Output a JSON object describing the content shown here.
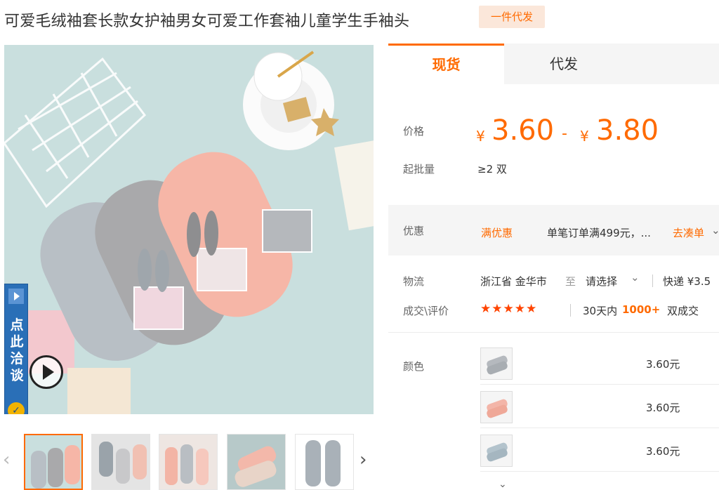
{
  "header": {
    "title": "可爱毛绒袖套长款女护袖男女可爱工作套袖儿童学生手袖头",
    "badge": "一件代发"
  },
  "gallery": {
    "chat_text": "点此洽谈",
    "chat_badge_icon": "shield-icon",
    "play_icon": "play-icon",
    "thumbnail_count": 5,
    "active_thumbnail": 1
  },
  "tabs": [
    {
      "label": "现货",
      "active": true
    },
    {
      "label": "代发",
      "active": false
    }
  ],
  "pricing": {
    "price_label": "价格",
    "currency": "¥",
    "price_min": "3.60",
    "dash": "-",
    "price_max": "3.80",
    "moq_label": "起批量",
    "moq_value": "≥2 双"
  },
  "promo": {
    "label": "优惠",
    "tag": "满优惠",
    "text": "单笔订单满499元，...",
    "link": "去凑单",
    "chevron_icon": "chevron-down-icon"
  },
  "logistics": {
    "label": "物流",
    "origin": "浙江省 金华市",
    "to": "至",
    "destination": "请选择",
    "shipping": "快递 ¥3.5"
  },
  "reviews": {
    "label": "成交\\评价",
    "stars": "★★★★★",
    "period": "30天内",
    "count": "1000+",
    "unit": "双成交"
  },
  "colors": {
    "label": "颜色",
    "items": [
      {
        "variant": "grey",
        "price": "3.60元"
      },
      {
        "variant": "pink",
        "price": "3.60元"
      },
      {
        "variant": "blue-grey",
        "price": "3.60元"
      }
    ]
  },
  "theme": {
    "accent": "#ff6a00",
    "chat_blue": "#2a6fb7"
  }
}
